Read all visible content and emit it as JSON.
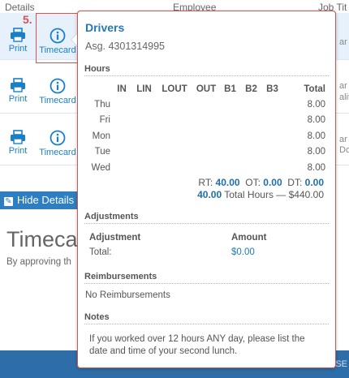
{
  "header": {
    "col_details": "Details",
    "col_employee": "Employee",
    "col_job_title": "Job Tit"
  },
  "rows": [
    {
      "print_label": "Print",
      "timecard_label": "Timecard",
      "right_text": "ar"
    },
    {
      "print_label": "Print",
      "timecard_label": "Timecard",
      "right_text": "ar"
    },
    {
      "print_label": "Print",
      "timecard_label": "Timecard",
      "right_text": "ar"
    }
  ],
  "row_right_extra": [
    "alit",
    "Do"
  ],
  "hide_details_label": "Hide Details",
  "page_title": "Timeca",
  "page_subtitle": "By approving th",
  "footer_text": "SE",
  "step_number": "5.",
  "popover": {
    "title": "Drivers",
    "subtitle": "Asg. 4301314995",
    "hours": {
      "section_label": "Hours",
      "columns": [
        "",
        "IN",
        "LIN",
        "LOUT",
        "OUT",
        "B1",
        "B2",
        "B3",
        "Total"
      ],
      "rows": [
        {
          "day": "Thu",
          "total": "8.00"
        },
        {
          "day": "Fri",
          "total": "8.00"
        },
        {
          "day": "Mon",
          "total": "8.00"
        },
        {
          "day": "Tue",
          "total": "8.00"
        },
        {
          "day": "Wed",
          "total": "8.00"
        }
      ],
      "rt_label": "RT:",
      "rt_value": "40.00",
      "ot_label": "OT:",
      "ot_value": "0.00",
      "dt_label": "DT:",
      "dt_value": "0.00",
      "total_hours_value": "40.00",
      "total_hours_text": "Total Hours — $440.00"
    },
    "adjustments": {
      "section_label": "Adjustments",
      "col_adjustment": "Adjustment",
      "col_amount": "Amount",
      "total_label": "Total:",
      "total_amount": "$0.00"
    },
    "reimbursements": {
      "section_label": "Reimbursements",
      "text": "No Reimbursements"
    },
    "notes": {
      "section_label": "Notes",
      "text": "If you worked over 12 hours ANY day, please list the date and time of your second lunch."
    }
  },
  "colors": {
    "accent": "#2479b3",
    "highlight_red": "#d9534f",
    "footer_blue": "#2e6ea8",
    "selected_row": "#e6f1fb"
  }
}
